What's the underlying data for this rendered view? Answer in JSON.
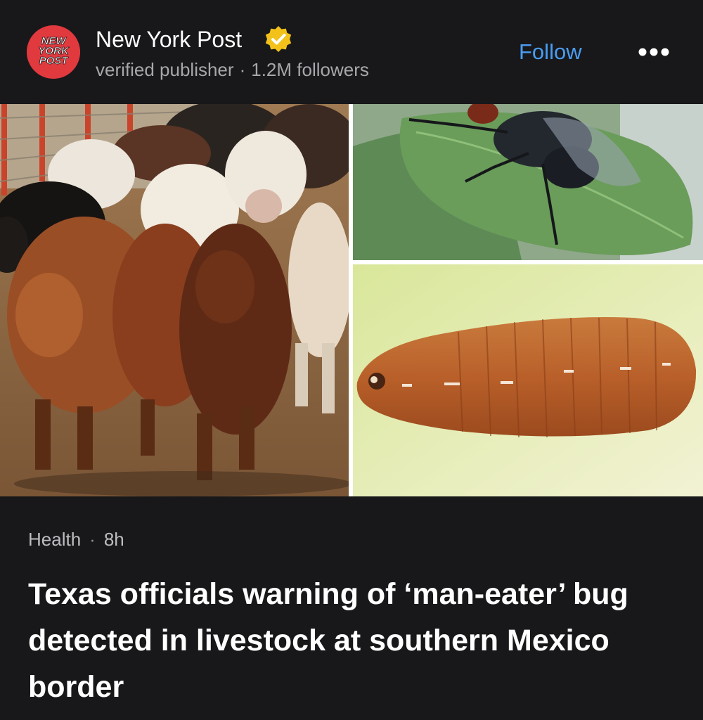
{
  "publisher": {
    "logo_text": [
      "NEW",
      "YORK",
      "POST"
    ],
    "name": "New York Post",
    "badge_icon": "verified-check-badge",
    "subtitle_status": "verified publisher",
    "subtitle_dot": "·",
    "subtitle_followers": "1.2M followers"
  },
  "actions": {
    "follow_label": "Follow",
    "more_icon": "more-horizontal-icon"
  },
  "images": [
    {
      "name": "cattle-herd-photo"
    },
    {
      "name": "fly-on-leaf-photo"
    },
    {
      "name": "larva-photo"
    }
  ],
  "article": {
    "category": "Health",
    "separator": "·",
    "age": "8h",
    "headline": "Texas officials warning of ‘man-eater’ bug detected in livestock at southern Mexico border"
  },
  "colors": {
    "background": "#18181a",
    "accent_link": "#4a9cf2",
    "brand_red": "#e0393e",
    "badge_gold": "#f2c21a"
  }
}
